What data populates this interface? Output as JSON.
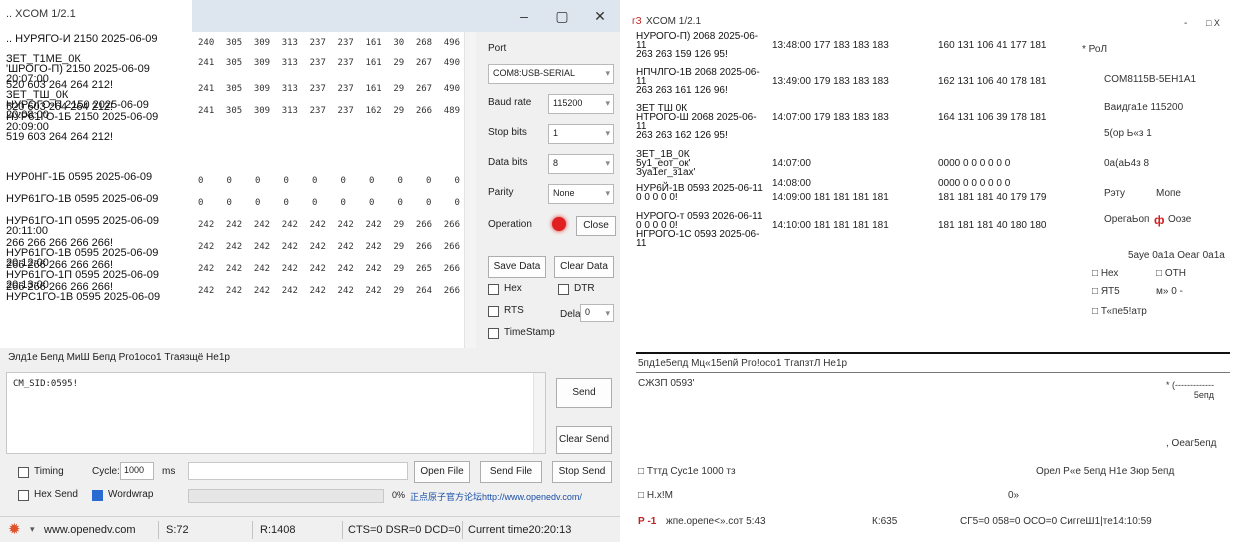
{
  "left": {
    "title": ".. XCOM 1/2.1",
    "win": {
      "min": "–",
      "max": "▢",
      "close": "✕"
    },
    "recv_lines": [
      {
        "label": ".. НУРЯГО-И 2150 2025-06-09",
        "nums": [
          "240",
          "305",
          "309",
          "313",
          "237",
          "237",
          "161",
          "30",
          "268",
          "496"
        ]
      },
      {
        "label": "ЗЕТ_Т1МЕ_0К\n'ШРОГО-П) 2150 2025-06-09 20:07:00",
        "nums": [
          "241",
          "305",
          "309",
          "313",
          "237",
          "237",
          "161",
          "29",
          "267",
          "490"
        ]
      },
      {
        "label": "520 603 264 264 212!\nЗЕТ_ТШ_0К\nНУРОГО-П 2150 2025-06-09 20:08:00",
        "nums": [
          "241",
          "305",
          "309",
          "313",
          "237",
          "237",
          "161",
          "29",
          "267",
          "490"
        ]
      },
      {
        "label": "520 603 264 264 212!\nНУР61ГО-1Б 2150 2025-06-09\n20:09:00\n519 603 264 264 212!",
        "nums": [
          "241",
          "305",
          "309",
          "313",
          "237",
          "237",
          "162",
          "29",
          "266",
          "489"
        ]
      },
      {
        "label": "НУР0НГ-1Б 0595 2025-06-09",
        "nums": [
          "0",
          "0",
          "0",
          "0",
          "0",
          "0",
          "0",
          "0",
          "0",
          "0"
        ]
      },
      {
        "label": "НУР61ГО-1В 0595 2025-06-09",
        "nums": [
          "0",
          "0",
          "0",
          "0",
          "0",
          "0",
          "0",
          "0",
          "0",
          "0"
        ]
      },
      {
        "label": "НУР61ГО-1П 0595 2025-06-09\n20:11:00",
        "nums": [
          "242",
          "242",
          "242",
          "242",
          "242",
          "242",
          "242",
          "29",
          "266",
          "266"
        ]
      },
      {
        "label": "266 266 266 266 266!\nНУР61ГО-1В 0595 2025-06-09\n20:12:00",
        "nums": [
          "242",
          "242",
          "242",
          "242",
          "242",
          "242",
          "242",
          "29",
          "266",
          "266"
        ]
      },
      {
        "label": "266 266 266 266 266!\nНУР61ГО-1П 0595 2025-06-09\n20:13:00",
        "nums": [
          "242",
          "242",
          "242",
          "242",
          "242",
          "242",
          "242",
          "29",
          "265",
          "266"
        ]
      },
      {
        "label": "266 266 266 266 266!\nНУРС1ГО-1В 0595 2025-06-09",
        "nums": [
          "242",
          "242",
          "242",
          "242",
          "242",
          "242",
          "242",
          "29",
          "264",
          "266"
        ]
      }
    ],
    "port_label": "Port",
    "port_value": "COM8:USB-SERIAL",
    "baud_label": "Baud rate",
    "baud_value": "115200",
    "stop_label": "Stop bits",
    "stop_value": "1",
    "data_label": "Data bits",
    "data_value": "8",
    "parity_label": "Parity",
    "parity_value": "None",
    "operation_label": "Operation",
    "close_btn": "Close",
    "save_data": "Save Data",
    "clear_data": "Clear Data",
    "hex_label": "Hex",
    "dtr_label": "DTR",
    "rts_label": "RTS",
    "delay_label": "Delay",
    "delay_value": "0",
    "timestamp_label": "TimeStamp",
    "menu_text": "Элд1е Бепд МиШ Бепд Рго1осо1 Тгаязщё Не1р",
    "send_text": "CM_SID:0595!",
    "send_btn": "Send",
    "clear_send_btn": "Clear Send",
    "timing_label": "Timing",
    "cycle_label": "Cycle:",
    "cycle_value": "1000",
    "ms_label": "ms",
    "open_file": "Open File",
    "send_file": "Send File",
    "stop_send": "Stop Send",
    "hex_send_label": "Hex Send",
    "wordwrap_label": "Wordwrap",
    "progress_pct": "0%",
    "promo": "正点原子官方论坛http://www.openedv.com/",
    "status": {
      "site": "www.openedv.com",
      "s": "S:72",
      "r": "R:1408",
      "lines": "CTS=0 DSR=0 DCD=0",
      "time": "Current time20:20:13"
    }
  },
  "right": {
    "title_prefix": "гЗ",
    "title": "XCOM 1/2.1",
    "win": {
      "min": "-",
      "close": "□ Х"
    },
    "lines": [
      {
        "label": "НУРОГО-П) 2068 2025-06-\n11\n263 263 159 126 95!",
        "time": "13:48:00 177 183 183 183",
        "rest": "160 131 106 41 177 181"
      },
      {
        "label": "НПЧЛГО-1В 2068 2025-06-\n11\n263 263 161 126 96!",
        "time": "13:49:00 179 183 183 183",
        "rest": "162 131 106 40 178 181"
      },
      {
        "label": "ЗЕТ ТШ 0К\nНТРОГО-Ш 2068 2025-06-\n11\n263 263 162 126 95!",
        "time": "14:07:00 179 183 183 183",
        "rest": "164 131 106 39 178 181"
      },
      {
        "label": "ЗЕТ_1В_0К\n5у1_еот_ок'\nЗуа1ег_з1ах'",
        "time": "14:07:00",
        "rest": "0000 0 0 0 0 0 0"
      },
      {
        "label": "",
        "time": "14:08:00",
        "rest": "0000 0 0 0 0 0 0"
      },
      {
        "label": "НУР6Й-1В 0593 2025-06-11\n0 0 0 0 0!",
        "time": "14:09:00 181 181 181 181",
        "rest": "181 181 181 40 179 179"
      },
      {
        "label": "НУРОГО-т 0593 2026-06-11\n0 0 0 0 0!\nНГРОГО-1С 0593 2025-06-\n11",
        "time": "14:10:00 181 181 181 181",
        "rest": "181 181 181 40 180 180"
      }
    ],
    "settings": {
      "port": "* РоЛ",
      "port_val": "COM8115B-5EH1A1",
      "baud": "Ваидга1е 115200",
      "stop": "5(ор Ь«з 1",
      "data": "0а(аЬ4з 8",
      "parity": "Рэту",
      "parity_val": "Мопе",
      "oper": "ОрегаЬоп",
      "oper_icon": "ф",
      "oper_close": "Оозе",
      "save": "5ауе 0а1а Оеаг 0а1а",
      "hex": "□ Нех",
      "oth": "□ ОТН",
      "rts": "□ ЯТ5",
      "delay": "м» 0 -",
      "ts": "□ Т«пе5!атр"
    },
    "menu": "5пд1е5епд Мц«15епй Рго!осо1 ТгапзтЛ Не1р",
    "send_text": "СЖЗП 0593'",
    "send_btn": "* (-------------\n5епд",
    "clear_send": ", Оеаг5епд",
    "timing": "□ Тттд Сус1е 1000 тз",
    "file_row": "Орел Р«е 5епд Н1е Зюр 5епд",
    "hex_send": "□ Н.х!М",
    "pct": "0»",
    "status_p": "Р -1",
    "status_site": "жпе.орепе<».сот 5:43",
    "status_k": "К:635",
    "status_lines": "СГ5=0 058=0 ОСО=0 СиггеШ1|те14:10:59"
  }
}
